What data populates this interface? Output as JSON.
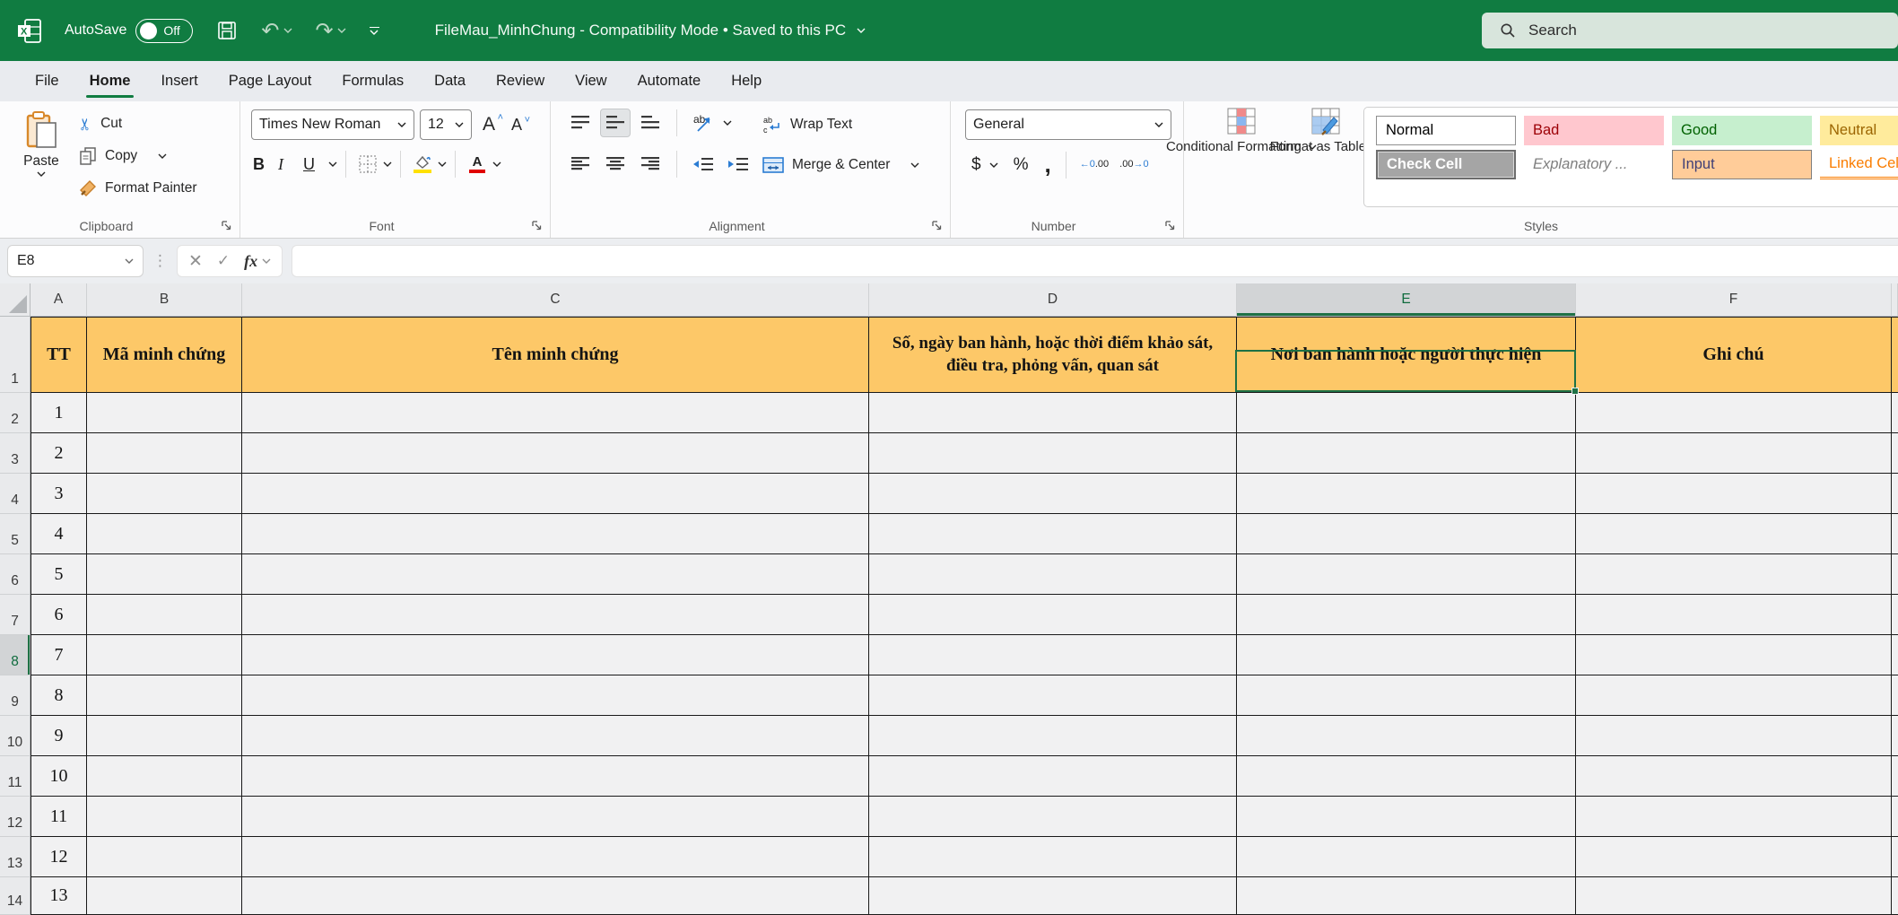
{
  "titlebar": {
    "autosave_label": "AutoSave",
    "autosave_state": "Off",
    "title": "FileMau_MinhChung  -  Compatibility Mode • Saved to this PC",
    "search_placeholder": "Search"
  },
  "menu_tabs": [
    {
      "label": "File",
      "active": false
    },
    {
      "label": "Home",
      "active": true
    },
    {
      "label": "Insert",
      "active": false
    },
    {
      "label": "Page Layout",
      "active": false
    },
    {
      "label": "Formulas",
      "active": false
    },
    {
      "label": "Data",
      "active": false
    },
    {
      "label": "Review",
      "active": false
    },
    {
      "label": "View",
      "active": false
    },
    {
      "label": "Automate",
      "active": false
    },
    {
      "label": "Help",
      "active": false
    }
  ],
  "ribbon": {
    "clipboard": {
      "label": "Clipboard",
      "paste": "Paste",
      "cut": "Cut",
      "copy": "Copy",
      "format_painter": "Format Painter"
    },
    "font": {
      "label": "Font",
      "family": "Times New Roman",
      "size": "12",
      "bold": "B",
      "italic": "I",
      "underline": "U"
    },
    "alignment": {
      "label": "Alignment",
      "wrap_text": "Wrap Text",
      "merge_center": "Merge & Center"
    },
    "number": {
      "label": "Number",
      "format": "General",
      "currency": "$",
      "percent": "%",
      "comma": ",",
      "inc_dec_top": "←0",
      "inc_dec_bottom": ".00",
      "dec_dec_top": ".00",
      "dec_dec_bottom": "→0"
    },
    "styles": {
      "label": "Styles",
      "conditional_formatting": "Conditional Formatting",
      "format_as_table": "Format as Table",
      "gallery": [
        {
          "label": "Normal",
          "style": "normal",
          "selected": true
        },
        {
          "label": "Bad",
          "style": "bad",
          "selected": false
        },
        {
          "label": "Good",
          "style": "good",
          "selected": false
        },
        {
          "label": "Neutral",
          "style": "neutral",
          "selected": false
        },
        {
          "label": "Check Cell",
          "style": "check",
          "selected": false
        },
        {
          "label": "Explanatory ...",
          "style": "explanatory",
          "selected": false
        },
        {
          "label": "Input",
          "style": "input",
          "selected": false
        },
        {
          "label": "Linked Cell",
          "style": "linked",
          "selected": false
        }
      ]
    }
  },
  "formula_bar": {
    "name_box": "E8",
    "fx_label": "fx",
    "formula": ""
  },
  "sheet": {
    "column_headers": [
      "A",
      "B",
      "C",
      "D",
      "E",
      "F"
    ],
    "selected_column": "E",
    "selected_row": 8,
    "selected_cell": "E8",
    "header_row": [
      "TT",
      "Mã minh chứng",
      "Tên minh chứng",
      "Số, ngày ban hành, hoặc thời điểm khảo sát, điều tra, phỏng vấn, quan sát",
      "Nơi ban hành hoặc người thực hiện",
      "Ghi chú"
    ],
    "column_a_values": [
      "1",
      "2",
      "3",
      "4",
      "5",
      "6",
      "7",
      "8",
      "9",
      "10",
      "11",
      "12",
      "13"
    ],
    "visible_row_numbers": [
      1,
      2,
      3,
      4,
      5,
      6,
      7,
      8,
      9,
      10,
      11,
      12,
      13,
      14
    ]
  },
  "colors": {
    "brand_green": "#107C41",
    "selection_green": "#1E7145",
    "header_fill": "#FDC868",
    "bad_bg": "#FFC7CE",
    "bad_text": "#9C0006",
    "good_bg": "#C6EFCE",
    "good_text": "#006100",
    "neutral_bg": "#FFEB9C",
    "neutral_text": "#9C6500",
    "check_bg": "#A5A5A5",
    "input_bg": "#FFCC99",
    "linked_text": "#FA7D00"
  }
}
